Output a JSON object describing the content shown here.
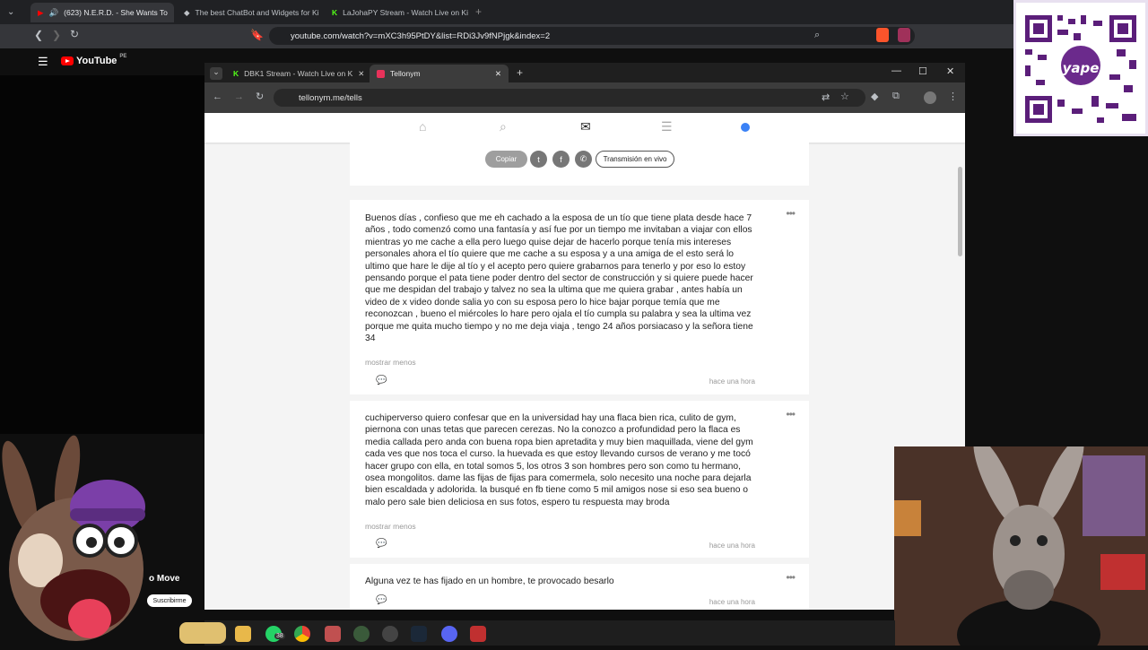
{
  "outer_browser": {
    "tabs": [
      {
        "label": "(623) N.E.R.D. - She Wants To",
        "active": true
      },
      {
        "label": "The best ChatBot and Widgets for Ki"
      },
      {
        "label": "LaJohaPY Stream - Watch Live on Ki"
      }
    ],
    "url": "youtube.com/watch?v=mXC3h95PtDY&list=RDi3Jv9fNPjgk&index=2"
  },
  "youtube": {
    "logo": "YouTube",
    "region": "PE"
  },
  "inner_browser": {
    "tabs": [
      {
        "label": "DBK1 Stream - Watch Live on K"
      },
      {
        "label": "Tellonym",
        "active": true
      }
    ],
    "url": "tellonym.me/tells"
  },
  "share": {
    "copy_label": "Copiar",
    "live_label": "Transmisión en vivo"
  },
  "posts": [
    {
      "text": "Buenos días , confieso que me eh cachado a la esposa de un tío que tiene plata desde hace 7 años , todo comenzó como una fantasía  y así fue por un tiempo me invitaban a viajar con ellos mientras yo me cache a ella pero luego quise dejar de hacerlo porque tenía mis intereses personales ahora el tío quiere que me cache a su esposa y a una amiga de el esto será lo ultimo que hare le dije al tío y el acepto pero quiere grabarnos para tenerlo y por eso lo estoy pensando porque  el pata tiene poder dentro del sector de construcción y si quiere puede hacer que me despidan del trabajo y talvez no sea la ultima que me quiera grabar , antes había un video de x video donde salia yo con su esposa pero lo hice bajar porque temía que me reconozcan , bueno el miércoles lo hare pero ojala el tío cumpla su palabra y sea la ultima vez porque me quita mucho tiempo y no me deja viaja , tengo 24 años porsiacaso y la señora tiene 34",
      "more": "mostrar menos",
      "time": "hace una hora"
    },
    {
      "text": "cuchiperverso quiero confesar que en la universidad hay una flaca bien rica, culito de gym, piernona con unas tetas que parecen cerezas. No la conozco a profundidad pero la  flaca es media callada pero anda con buena ropa bien apretadita y muy bien maquillada, viene del gym cada ves que nos toca el curso. la huevada es que estoy llevando cursos de verano y me tocó hacer grupo con ella, en total somos 5, los otros 3 son hombres pero son como tu hermano, osea mongolitos. dame las fijas de fijas para comermela, solo necesito una noche para dejarla bien escaldada y adolorida. la busqué en fb tiene como 5 mil amigos nose si eso sea bueno o malo pero sale bien deliciosa en sus fotos, espero tu respuesta may broda",
      "more": "mostrar menos",
      "time": "hace una hora"
    },
    {
      "text": "Alguna vez te has fijado en un hombre, te provocado besarlo",
      "time": "hace una hora"
    }
  ],
  "overlay": {
    "channel_fragment": "o Move",
    "subscribe": "Suscribirme",
    "qr_brand": "yape"
  },
  "taskbar": {
    "whatsapp_badge": "38"
  },
  "colors": {
    "accent": "#8b5cf6",
    "youtube_red": "#ff0000",
    "page_bg": "#f4f4f4"
  }
}
